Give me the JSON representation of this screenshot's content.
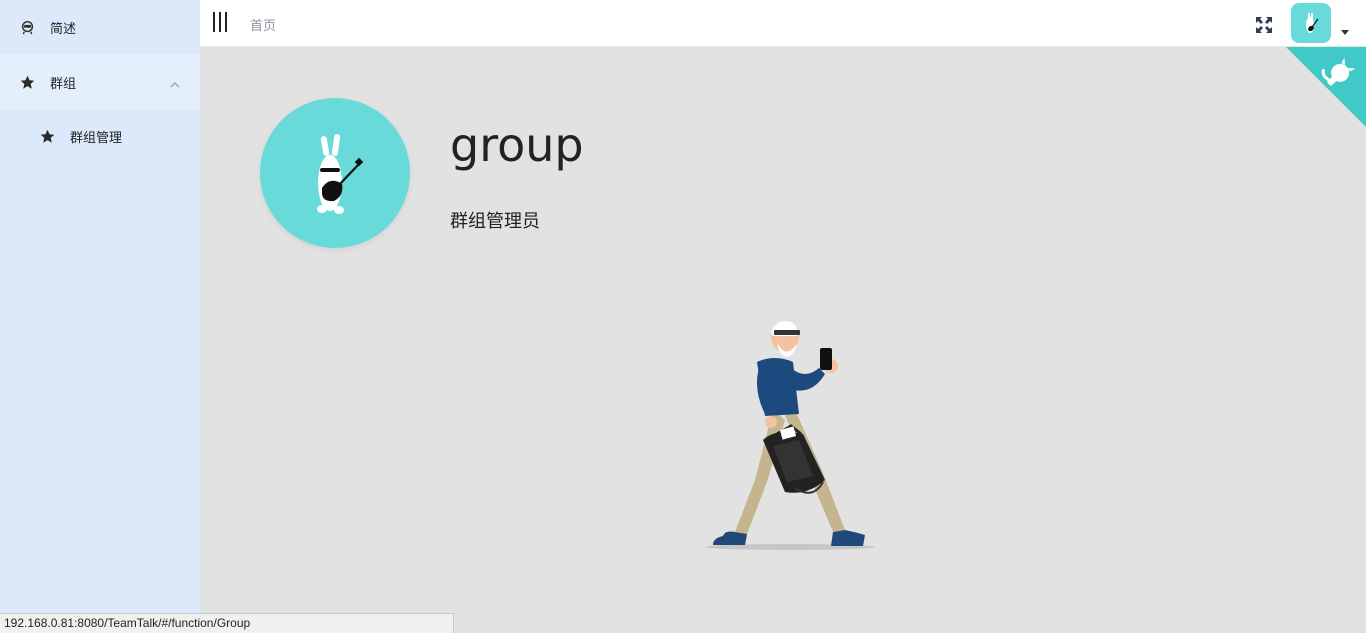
{
  "sidebar": {
    "items": [
      {
        "label": "简述",
        "icon": "robot-face-icon"
      },
      {
        "label": "群组",
        "icon": "star-icon",
        "expanded": true,
        "children": [
          {
            "label": "群组管理",
            "icon": "star-icon"
          }
        ]
      }
    ]
  },
  "header": {
    "breadcrumb": "首页",
    "icons": [
      "hamburger-icon",
      "fullscreen-icon",
      "user-avatar",
      "caret-down-icon"
    ]
  },
  "profile": {
    "name": "group",
    "role": "群组管理员"
  },
  "github_corner": {
    "icon": "octocat-icon",
    "color": "#40c9c6"
  },
  "statusbar": {
    "url": "192.168.0.81:8080/TeamTalk/#/function/Group"
  },
  "colors": {
    "sidebar_bg": "#dbe9fb",
    "avatar_bg": "#67dad9",
    "main_bg": "#e2e2e2"
  }
}
